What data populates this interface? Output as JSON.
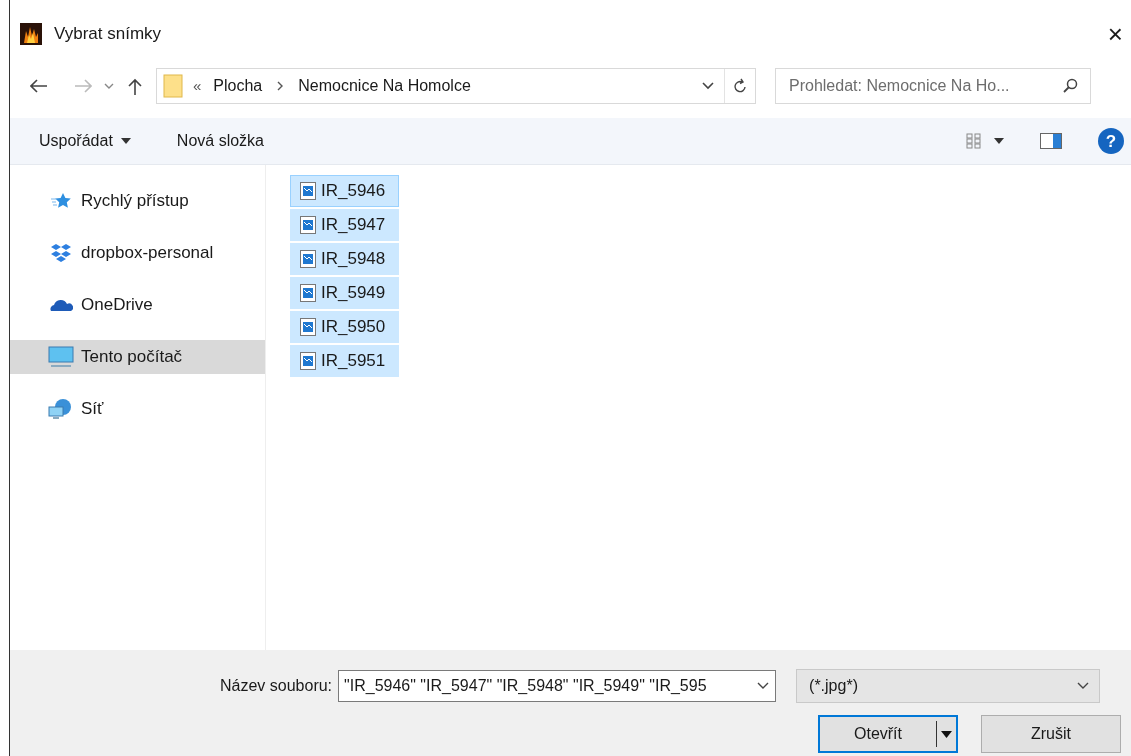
{
  "window": {
    "title": "Vybrat snímky",
    "close": "×"
  },
  "nav": {
    "path": [
      {
        "label": "Plocha"
      },
      {
        "label": "Nemocnice Na Homolce"
      }
    ],
    "overflow": "«",
    "search_placeholder": "Prohledat: Nemocnice Na Ho..."
  },
  "toolbar": {
    "organize": "Uspořádat",
    "new_folder": "Nová složka",
    "help": "?"
  },
  "sidebar": {
    "items": [
      {
        "label": "Rychlý přístup",
        "kind": "star",
        "selected": false
      },
      {
        "label": "dropbox-personal",
        "kind": "dropbox",
        "selected": false
      },
      {
        "label": "OneDrive",
        "kind": "cloud",
        "selected": false
      },
      {
        "label": "Tento počítač",
        "kind": "pc",
        "selected": true
      },
      {
        "label": "Síť",
        "kind": "network",
        "selected": false
      }
    ]
  },
  "files": [
    {
      "name": "IR_5946",
      "selected": true,
      "focused": true
    },
    {
      "name": "IR_5947",
      "selected": true,
      "focused": false
    },
    {
      "name": "IR_5948",
      "selected": true,
      "focused": false
    },
    {
      "name": "IR_5949",
      "selected": true,
      "focused": false
    },
    {
      "name": "IR_5950",
      "selected": true,
      "focused": false
    },
    {
      "name": "IR_5951",
      "selected": true,
      "focused": false
    }
  ],
  "footer": {
    "filename_label": "Název souboru:",
    "filename_value": "\"IR_5946\" \"IR_5947\" \"IR_5948\" \"IR_5949\" \"IR_595",
    "filter": "(*.jpg*)",
    "open": "Otevřít",
    "cancel": "Zrušit"
  }
}
